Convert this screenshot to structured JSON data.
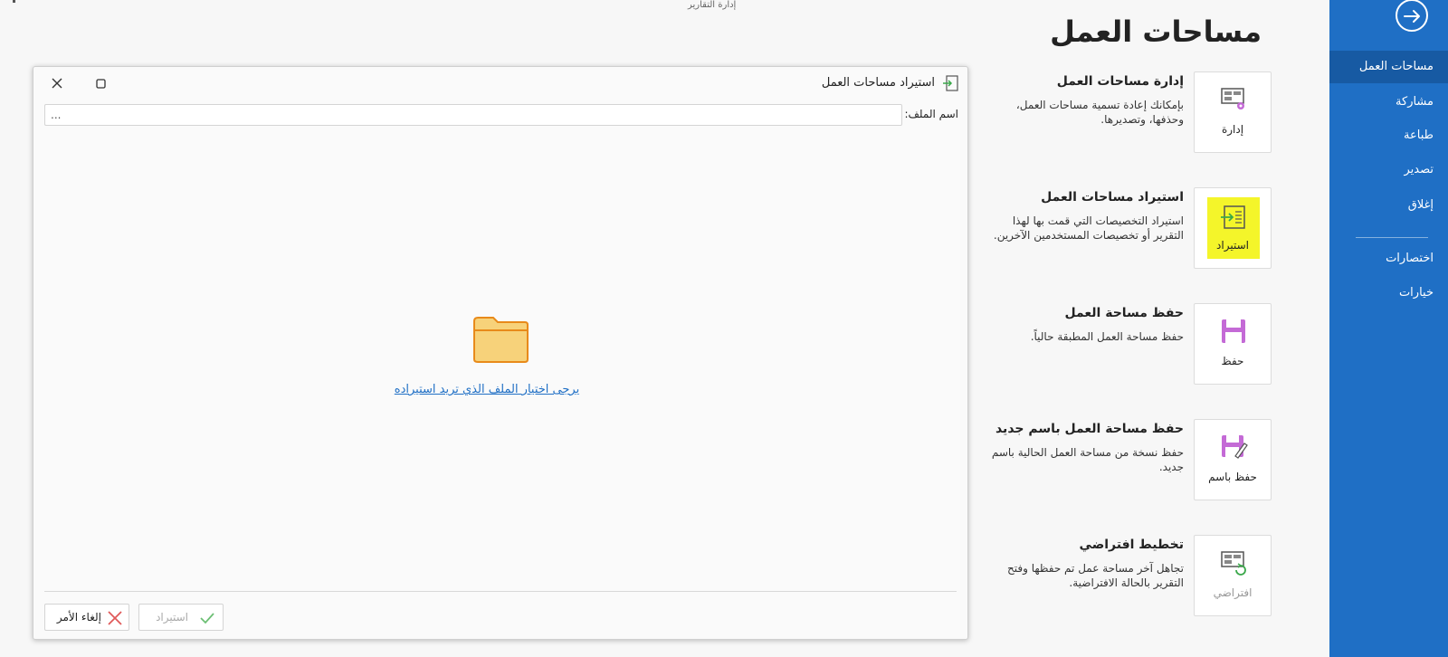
{
  "top_strip": "إدارة التقارير",
  "page_title": "مساحات العمل",
  "sidebar": {
    "items": [
      {
        "label": "مساحات العمل",
        "active": true
      },
      {
        "label": "مشاركة"
      },
      {
        "label": "طباعة"
      },
      {
        "label": "تصدير"
      },
      {
        "label": "إغلاق"
      },
      {
        "label": "اختصارات"
      },
      {
        "label": "خيارات"
      }
    ]
  },
  "cards": [
    {
      "label": "إدارة",
      "icon": "monitor-gear-icon",
      "title": "إدارة مساحات العمل",
      "desc": "بإمكانك إعادة تسمية مساحات العمل، وحذفها، وتصديرها."
    },
    {
      "label": "استيراد",
      "icon": "import-icon",
      "title": "استيراد مساحات العمل",
      "desc": "استيراد التخصيصات التي قمت بها لهذا التقرير أو تخصيصات المستخدمين الآخرين."
    },
    {
      "label": "حفظ",
      "icon": "save-icon",
      "title": "حفظ مساحة العمل",
      "desc": "حفظ مساحة العمل المطبقة حالياً."
    },
    {
      "label": "حفظ باسم",
      "icon": "save-as-icon",
      "title": "حفظ مساحة العمل باسم جديد",
      "desc": "حفظ نسخة من مساحة العمل الحالية باسم جديد."
    },
    {
      "label": "افتراضي",
      "icon": "monitor-reset-icon",
      "title": "تخطيط افتراضي",
      "desc": "تجاهل آخر مساحة عمل تم حفظها وفتح التقرير بالحالة الافتراضية."
    }
  ],
  "dialog": {
    "title": "استيراد مساحات العمل",
    "file_label": "اسم الملف:",
    "file_value": "...",
    "pick_link": "يرجى اختيار الملف الذي تريد استيراده",
    "import_button": "استيراد",
    "cancel_button": "إلغاء الأمر"
  },
  "colors": {
    "sidebar": "#1f6fc5",
    "accent": "#1f6fc5",
    "highlight": "#f4f52a",
    "icon_purple": "#c46ad6",
    "folder": "#f7d27a"
  }
}
